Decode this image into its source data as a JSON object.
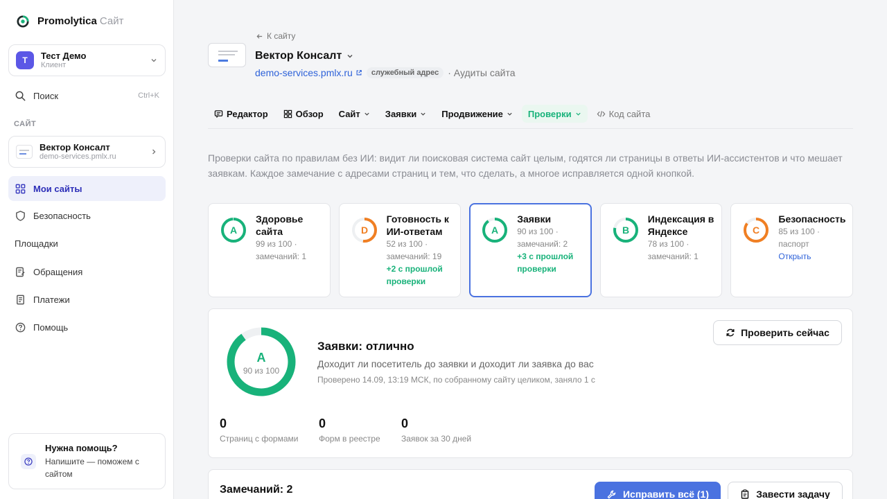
{
  "app": {
    "name": "Promolytica",
    "sub": "Сайт"
  },
  "account": {
    "initial": "Т",
    "name": "Тест Демо",
    "role": "Клиент"
  },
  "nav": {
    "search_label": "Поиск",
    "search_shortcut": "Ctrl+K",
    "section_label": "САЙТ",
    "site": {
      "name": "Вектор Консалт",
      "url": "demo-services.pmlx.ru"
    },
    "my_sites": "Мои сайты",
    "security": "Безопасность",
    "platforms": "Площадки",
    "requests": "Обращения",
    "payments": "Платежи",
    "help": "Помощь"
  },
  "help_card": {
    "title": "Нужна помощь?",
    "text": "Напишите — поможем с сайтом"
  },
  "header": {
    "back": "К сайту",
    "title": "Вектор Консалт",
    "url": "demo-services.pmlx.ru",
    "badge": "служебный адрес",
    "breadcrumb_tail": "· Аудиты сайта"
  },
  "tabs": [
    {
      "label": "Редактор"
    },
    {
      "label": "Обзор"
    },
    {
      "label": "Сайт"
    },
    {
      "label": "Заявки"
    },
    {
      "label": "Продвижение"
    },
    {
      "label": "Проверки"
    },
    {
      "label": "Код сайта"
    }
  ],
  "intro": "Проверки сайта по правилам без ИИ: видит ли поисковая система сайт целым, годятся ли страницы в ответы ИИ-ассистентов и что мешает заявкам. Каждое замечание с адресами страниц и тем, что сделать, а многое исправляется одной кнопкой.",
  "cards": [
    {
      "grade": "A",
      "score": 99,
      "color": "#18b27a",
      "title": "Здоровье сайта",
      "stat": "99 из 100 · замечаний: 1",
      "delta": "",
      "link": ""
    },
    {
      "grade": "D",
      "score": 52,
      "color": "#f07f23",
      "title": "Готовность к ИИ-ответам",
      "stat": "52 из 100 · замечаний: 19",
      "delta": "+2 с прошлой проверки",
      "link": ""
    },
    {
      "grade": "A",
      "score": 90,
      "color": "#18b27a",
      "title": "Заявки",
      "stat": "90 из 100 · замечаний: 2",
      "delta": "+3 с прошлой проверки",
      "link": ""
    },
    {
      "grade": "B",
      "score": 78,
      "color": "#18b27a",
      "title": "Индексация в Яндексе",
      "stat": "78 из 100 · замечаний: 1",
      "delta": "",
      "link": ""
    },
    {
      "grade": "C",
      "score": 85,
      "color": "#f07f23",
      "title": "Безопасность",
      "stat": "85 из 100 · паспорт",
      "delta": "",
      "link": "Открыть"
    }
  ],
  "detail": {
    "grade": "A",
    "score_label": "90 из 100",
    "score": 90,
    "title": "Заявки: отлично",
    "subtitle": "Доходит ли посетитель до заявки и доходит ли заявка до вас",
    "meta": "Проверено 14.09, 13:19 МСК, по собранному сайту целиком, заняло 1 с",
    "check_button": "Проверить сейчас",
    "stats": [
      {
        "value": "0",
        "label": "Страниц с формами"
      },
      {
        "value": "0",
        "label": "Форм в реестре"
      },
      {
        "value": "0",
        "label": "Заявок за 30 дней"
      }
    ]
  },
  "issues": {
    "title": "Замечаний: 2",
    "fix_button": "Исправить всё (1)",
    "task_button": "Завести задачу"
  },
  "colors": {
    "accent": "#4a72e0",
    "good": "#18b27a",
    "warn": "#f07f23",
    "link": "#2e62d9"
  }
}
